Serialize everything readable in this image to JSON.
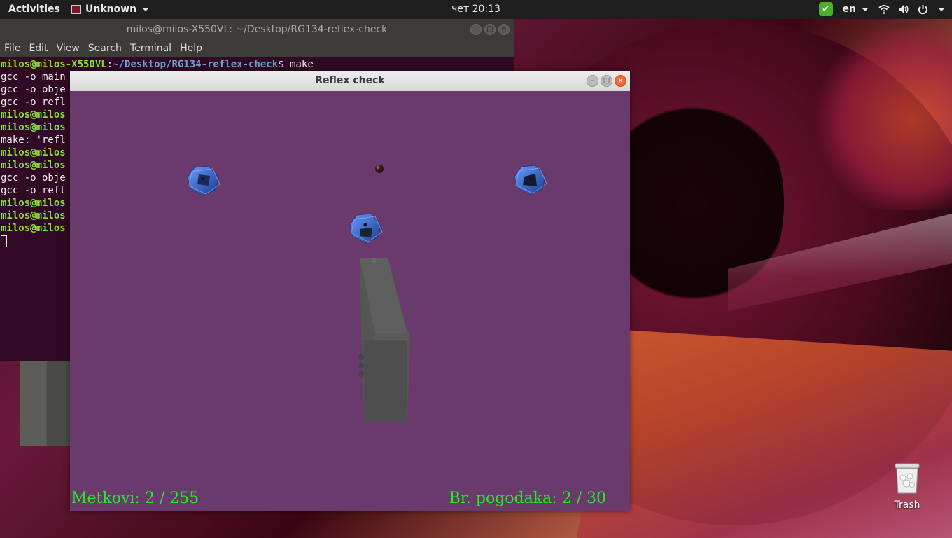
{
  "topbar": {
    "activities": "Activities",
    "app_name": "Unknown",
    "clock": "чет 20:13",
    "language": "en",
    "icons": [
      "checkmark-icon",
      "wifi-icon",
      "volume-icon",
      "power-icon",
      "chevron-down-icon"
    ]
  },
  "terminal": {
    "title": "milos@milos-X550VL: ~/Desktop/RG134-reflex-check",
    "menu": [
      "File",
      "Edit",
      "View",
      "Search",
      "Terminal",
      "Help"
    ],
    "prompt_user": "milos@milos-X550VL",
    "prompt_path": "~/Desktop/RG134-reflex-check",
    "prompt_cmd": "$ make",
    "lines": [
      {
        "kind": "text",
        "text": "gcc -o main"
      },
      {
        "kind": "text",
        "text": "gcc -o obje"
      },
      {
        "kind": "text",
        "text": "gcc -o refl"
      },
      {
        "kind": "prompt",
        "text": "milos@milos"
      },
      {
        "kind": "prompt",
        "text": "milos@milos"
      },
      {
        "kind": "text",
        "text": "make: 'refl"
      },
      {
        "kind": "prompt",
        "text": "milos@milos"
      },
      {
        "kind": "prompt",
        "text": "milos@milos"
      },
      {
        "kind": "text",
        "text": "gcc -o obje"
      },
      {
        "kind": "text",
        "text": "gcc -o refl"
      },
      {
        "kind": "prompt",
        "text": "milos@milos"
      },
      {
        "kind": "prompt",
        "text": "milos@milos"
      },
      {
        "kind": "prompt",
        "text": "milos@milos"
      }
    ]
  },
  "reflex": {
    "title": "Reflex check",
    "hud_left": "Metkovi: 2 / 255",
    "hud_right": "Br. pogodaka: 2 / 30",
    "background_color": "#693a6b",
    "hud_color": "#22ee22"
  },
  "desktop": {
    "trash_label": "Trash"
  }
}
